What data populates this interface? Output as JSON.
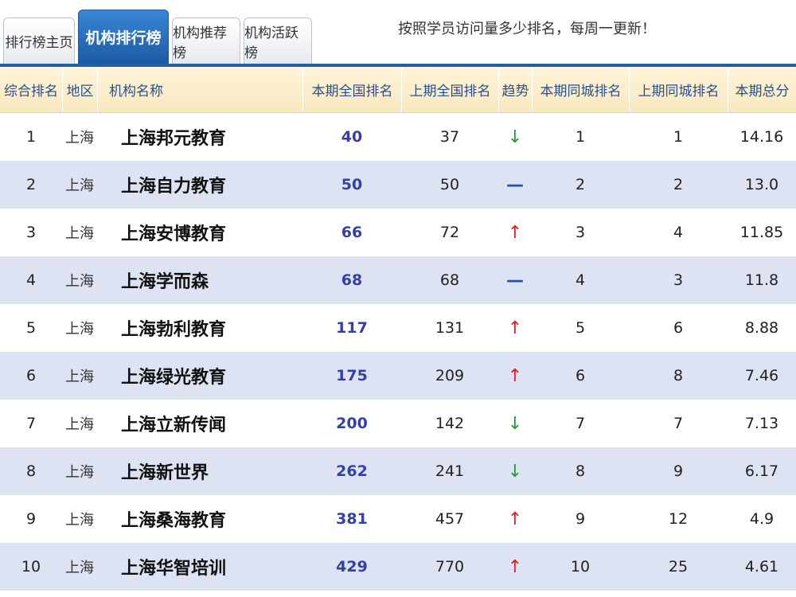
{
  "tabs": [
    {
      "label": "排行榜主页",
      "active": false
    },
    {
      "label": "机构排行榜",
      "active": true
    },
    {
      "label": "机构推荐榜",
      "active": false
    },
    {
      "label": "机构活跃榜",
      "active": false
    }
  ],
  "notice": "按照学员访问量多少排名，每周一更新！",
  "headers": {
    "rank": "综合排名",
    "region": "地区",
    "name": "机构名称",
    "nat_current": "本期全国排名",
    "nat_previous": "上期全国排名",
    "trend": "趋势",
    "city_current": "本期同城排名",
    "city_previous": "上期同城排名",
    "score": "本期总分"
  },
  "rows": [
    {
      "rank": "1",
      "region": "上海",
      "name": "上海邦元教育",
      "nat_current": "40",
      "nat_previous": "37",
      "trend": "down",
      "city_current": "1",
      "city_previous": "1",
      "score": "14.16"
    },
    {
      "rank": "2",
      "region": "上海",
      "name": "上海自力教育",
      "nat_current": "50",
      "nat_previous": "50",
      "trend": "flat",
      "city_current": "2",
      "city_previous": "2",
      "score": "13.0"
    },
    {
      "rank": "3",
      "region": "上海",
      "name": "上海安博教育",
      "nat_current": "66",
      "nat_previous": "72",
      "trend": "up",
      "city_current": "3",
      "city_previous": "4",
      "score": "11.85"
    },
    {
      "rank": "4",
      "region": "上海",
      "name": "上海学而森",
      "nat_current": "68",
      "nat_previous": "68",
      "trend": "flat",
      "city_current": "4",
      "city_previous": "3",
      "score": "11.8"
    },
    {
      "rank": "5",
      "region": "上海",
      "name": "上海勃利教育",
      "nat_current": "117",
      "nat_previous": "131",
      "trend": "up",
      "city_current": "5",
      "city_previous": "6",
      "score": "8.88"
    },
    {
      "rank": "6",
      "region": "上海",
      "name": "上海绿光教育",
      "nat_current": "175",
      "nat_previous": "209",
      "trend": "up",
      "city_current": "6",
      "city_previous": "8",
      "score": "7.46"
    },
    {
      "rank": "7",
      "region": "上海",
      "name": "上海立新传闻",
      "nat_current": "200",
      "nat_previous": "142",
      "trend": "down",
      "city_current": "7",
      "city_previous": "7",
      "score": "7.13"
    },
    {
      "rank": "8",
      "region": "上海",
      "name": "上海新世界",
      "nat_current": "262",
      "nat_previous": "241",
      "trend": "down",
      "city_current": "8",
      "city_previous": "9",
      "score": "6.17"
    },
    {
      "rank": "9",
      "region": "上海",
      "name": "上海桑海教育",
      "nat_current": "381",
      "nat_previous": "457",
      "trend": "up",
      "city_current": "9",
      "city_previous": "12",
      "score": "4.9"
    },
    {
      "rank": "10",
      "region": "上海",
      "name": "上海华智培训",
      "nat_current": "429",
      "nat_previous": "770",
      "trend": "up",
      "city_current": "10",
      "city_previous": "25",
      "score": "4.61"
    }
  ],
  "trend_symbols": {
    "up": "↑",
    "down": "↓",
    "flat": "—"
  },
  "colors": {
    "accent": "#1d5fa6",
    "header_bg": "#fff4d9",
    "alt_row": "#dde3f2",
    "up": "#e02020",
    "down": "#2a9a3a",
    "flat": "#2a4fa8"
  }
}
